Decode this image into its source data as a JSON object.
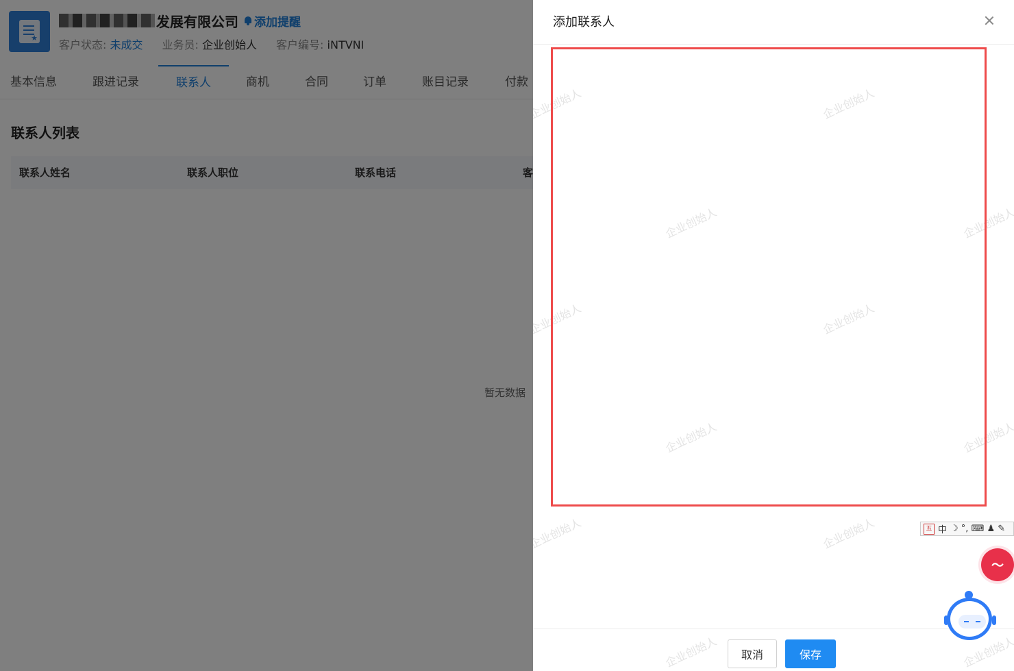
{
  "header": {
    "company_name": "发展有限公司",
    "remind_label": "添加提醒",
    "status_label": "客户状态:",
    "status_value": "未成交",
    "salesman_label": "业务员:",
    "salesman_value": "企业创始人",
    "code_label": "客户编号:",
    "code_value": "iNTVNI"
  },
  "tabs": [
    {
      "label": "基本信息"
    },
    {
      "label": "跟进记录"
    },
    {
      "label": "联系人"
    },
    {
      "label": "商机"
    },
    {
      "label": "合同"
    },
    {
      "label": "订单"
    },
    {
      "label": "账目记录"
    },
    {
      "label": "付款"
    }
  ],
  "main": {
    "section_title": "联系人列表",
    "columns": [
      "联系人姓名",
      "联系人职位",
      "联系电话",
      "客"
    ],
    "empty_text": "暂无数据"
  },
  "drawer": {
    "title": "添加联系人",
    "cancel_label": "取消",
    "save_label": "保存",
    "watermark": "企业创始人"
  },
  "ime": {
    "logo": "五",
    "mode": "中",
    "icons": "☽ °, ⌨ ♟ ✎"
  },
  "colors": {
    "accent": "#1f8bf2",
    "highlight_frame": "#ee4b4b"
  }
}
